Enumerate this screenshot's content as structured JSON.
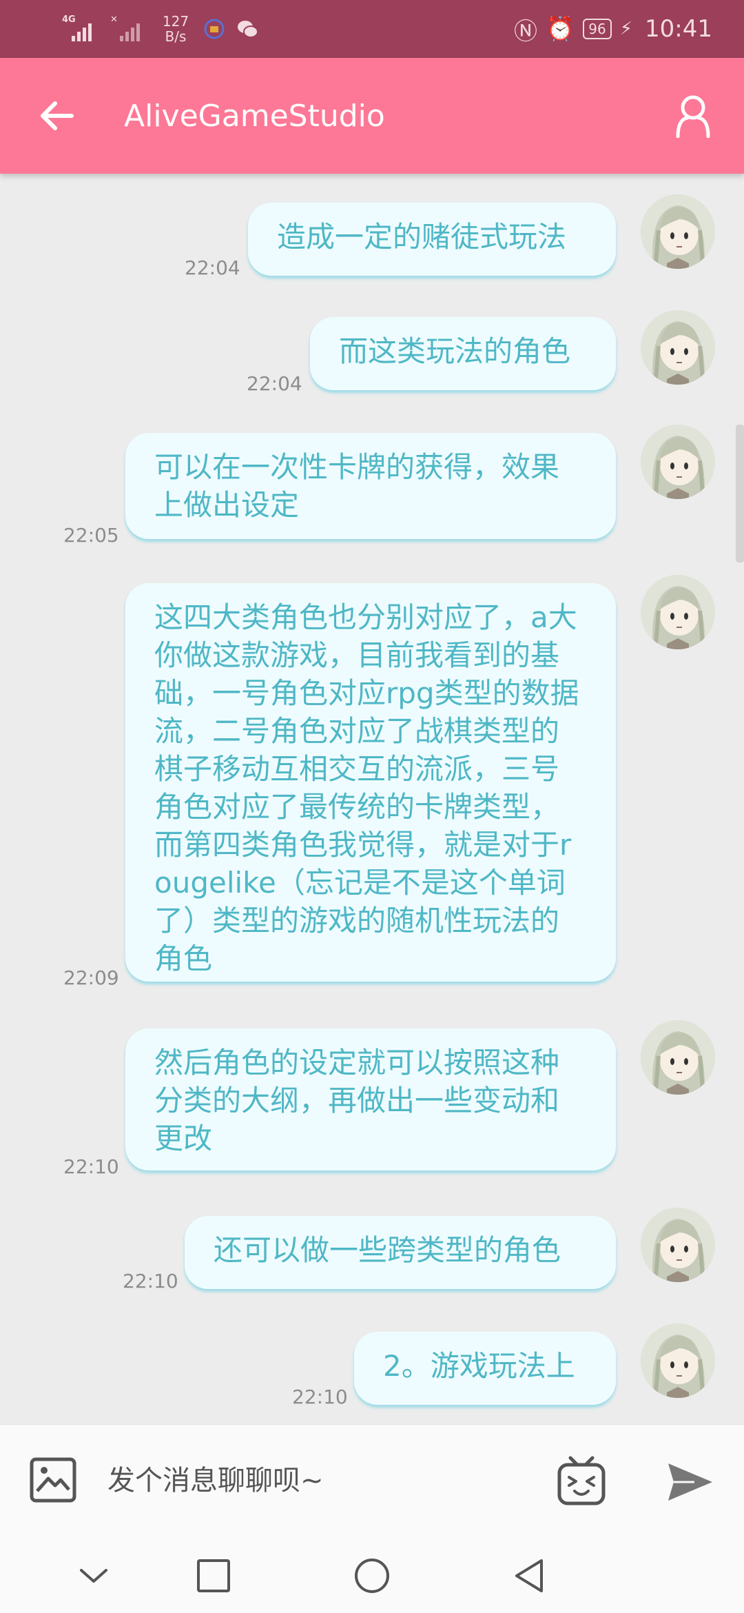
{
  "status_bar": {
    "signal1_label": "4G",
    "speed_value": "127",
    "speed_unit": "B/s",
    "battery": "96",
    "time": "10:41"
  },
  "app_bar": {
    "title": "AliveGameStudio"
  },
  "messages": [
    {
      "text": "造成一定的赌徒式玩法",
      "time": "22:04"
    },
    {
      "text": "而这类玩法的角色",
      "time": "22:04"
    },
    {
      "text": "可以在一次性卡牌的获得，效果上做出设定",
      "time": "22:05"
    },
    {
      "text": "这四大类角色也分别对应了，a大你做这款游戏，目前我看到的基础，一号角色对应rpg类型的数据流，二号角色对应了战棋类型的棋子移动互相交互的流派，三号角色对应了最传统的卡牌类型，而第四类角色我觉得，就是对于rougelike（忘记是不是这个单词了）类型的游戏的随机性玩法的角色",
      "time": "22:09"
    },
    {
      "text": "然后角色的设定就可以按照这种分类的大纲，再做出一些变动和更改",
      "time": "22:10"
    },
    {
      "text": "还可以做一些跨类型的角色",
      "time": "22:10"
    },
    {
      "text": "2。游戏玩法上",
      "time": "22:10"
    }
  ],
  "input": {
    "placeholder": "发个消息聊聊呗~"
  },
  "colors": {
    "status_bar": "#9b3f5a",
    "app_bar": "#fd7896",
    "bubble_bg": "#effcff",
    "bubble_text": "#4fb7c6",
    "chat_bg": "#ececec"
  }
}
